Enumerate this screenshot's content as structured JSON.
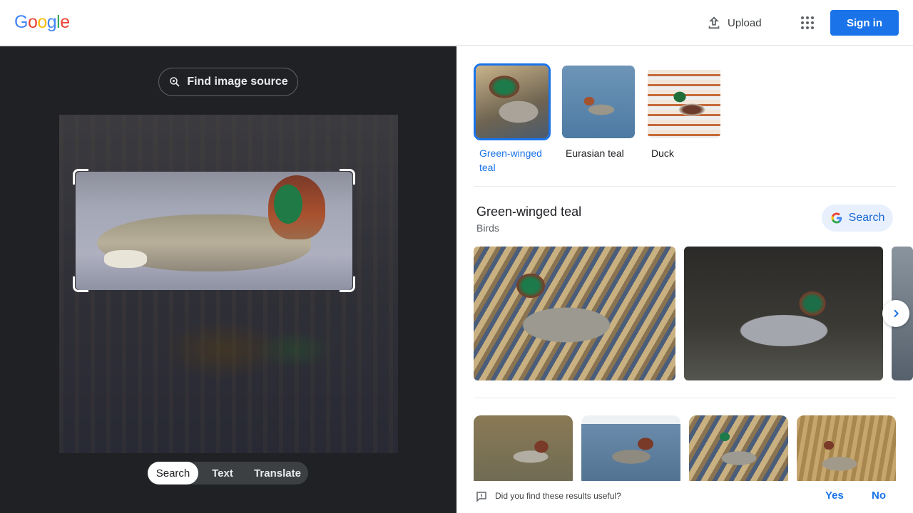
{
  "header": {
    "logo": [
      "G",
      "o",
      "o",
      "g",
      "l",
      "e"
    ],
    "logo_colors": [
      "#4285F4",
      "#EA4335",
      "#FBBC05",
      "#4285F4",
      "#34A853",
      "#EA4335"
    ],
    "upload_label": "Upload",
    "signin_label": "Sign in"
  },
  "left": {
    "find_source_label": "Find image source",
    "modes": [
      {
        "label": "Search",
        "active": true
      },
      {
        "label": "Text",
        "active": false
      },
      {
        "label": "Translate",
        "active": false
      }
    ]
  },
  "right": {
    "entities": [
      {
        "label": "Green-winged teal",
        "active": true
      },
      {
        "label": "Eurasian teal",
        "active": false
      },
      {
        "label": "Duck",
        "active": false
      }
    ],
    "result": {
      "title": "Green-winged teal",
      "subtitle": "Birds",
      "search_label": "Search"
    },
    "feedback": {
      "question": "Did you find these results useful?",
      "yes": "Yes",
      "no": "No"
    }
  },
  "colors": {
    "accent": "#1a73e8",
    "left_bg": "#202124"
  }
}
